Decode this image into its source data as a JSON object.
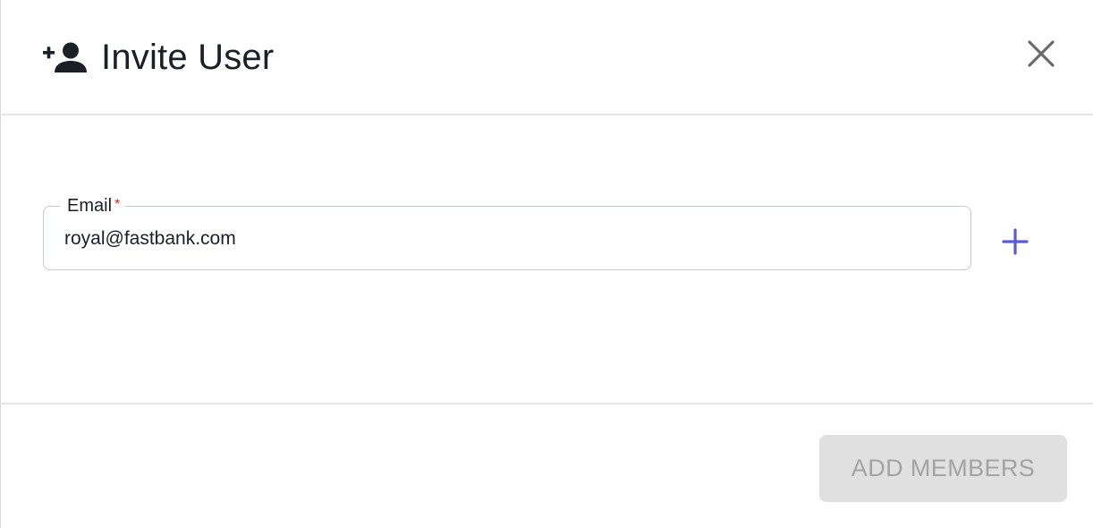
{
  "dialog": {
    "title": "Invite User",
    "title_icon": "person-add-icon",
    "close_icon": "close-icon"
  },
  "form": {
    "email": {
      "label": "Email",
      "required_mark": "*",
      "value": "royal@fastbank.com"
    },
    "add_field_icon": "plus-icon"
  },
  "footer": {
    "submit_label": "ADD MEMBERS",
    "submit_disabled": true
  },
  "colors": {
    "accent": "#5b5bd6",
    "required": "#d32f2f",
    "disabled_bg": "#e0e0e0",
    "disabled_text": "#a3a3a3",
    "divider": "#e3e5ea"
  }
}
